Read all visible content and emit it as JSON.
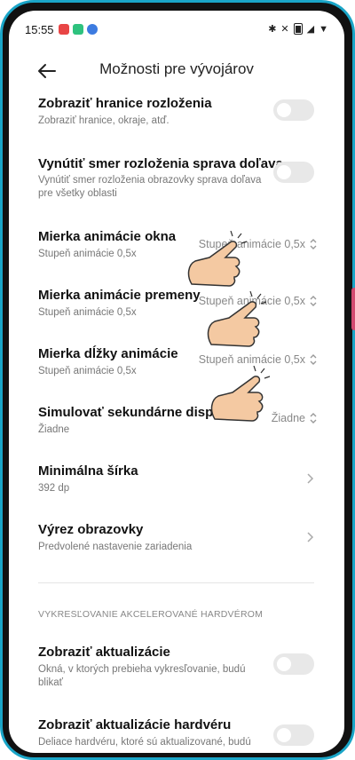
{
  "status": {
    "time": "15:55"
  },
  "header": {
    "title": "Možnosti pre vývojárov"
  },
  "rows": [
    {
      "title": "Zobraziť hranice rozloženia",
      "subtitle": "Zobraziť hranice, okraje, atď."
    },
    {
      "title": "Vynútiť smer rozloženia sprava doľava",
      "subtitle": "Vynútiť smer rozloženia obrazovky sprava doľava pre všetky oblasti"
    },
    {
      "title": "Mierka animácie okna",
      "subtitle": "Stupeň animácie 0,5x",
      "value": "Stupeň animácie 0,5x"
    },
    {
      "title": "Mierka animácie premeny",
      "subtitle": "Stupeň animácie 0,5x",
      "value": "Stupeň animácie 0,5x"
    },
    {
      "title": "Mierka dĺžky animácie",
      "subtitle": "Stupeň animácie 0,5x",
      "value": "Stupeň animácie 0,5x"
    },
    {
      "title": "Simulovať sekundárne displeje",
      "subtitle": "Žiadne",
      "value": "Žiadne"
    },
    {
      "title": "Minimálna šírka",
      "subtitle": "392 dp"
    },
    {
      "title": "Výrez obrazovky",
      "subtitle": "Predvolené nastavenie zariadenia"
    }
  ],
  "section": {
    "label": "VYKRESĽOVANIE AKCELEROVANÉ HARDVÉROM"
  },
  "rows2": [
    {
      "title": "Zobraziť aktualizácie",
      "subtitle": "Okná, v ktorých prebieha vykresľovanie, budú blikať"
    },
    {
      "title": "Zobraziť aktualizácie hardvéru",
      "subtitle": "Deliace hardvéru, ktoré sú aktualizované, budú"
    }
  ]
}
